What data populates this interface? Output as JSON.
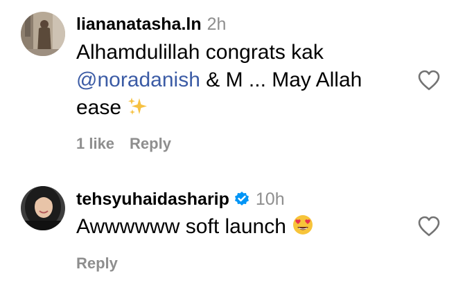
{
  "comments": [
    {
      "username": "liananatasha.ln",
      "time": "2h",
      "line1": "Alhamdulillah congrats kak",
      "mention": "@noradanish",
      "line2_rest": " & M ... May Allah",
      "line3": "ease",
      "line3_emoji": "sparkles-icon",
      "likes": "1 like",
      "reply": "Reply",
      "verified": false
    },
    {
      "username": "tehsyuhaidasharip",
      "time": "10h",
      "line1": "Awwwwww soft launch",
      "line1_emoji": "heart-eyes-emoji-icon",
      "reply": "Reply",
      "verified": true
    }
  ],
  "colors": {
    "mention": "#3b5ba5",
    "meta": "#8e8e8e",
    "verified": "#0095f6"
  }
}
